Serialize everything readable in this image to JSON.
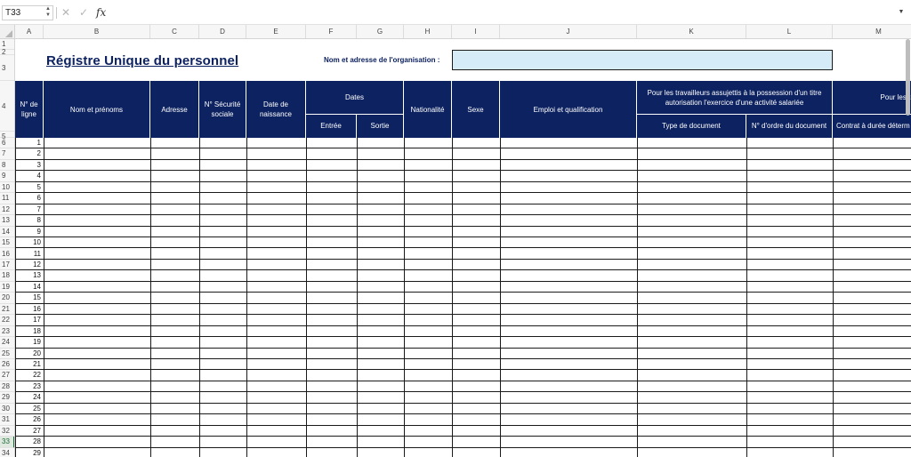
{
  "formula_bar": {
    "cell_ref": "T33",
    "cancel_icon": "close-icon",
    "confirm_icon": "check-icon",
    "function_symbol": "fx",
    "formula": ""
  },
  "columns": [
    "A",
    "B",
    "C",
    "D",
    "E",
    "F",
    "G",
    "H",
    "I",
    "J",
    "K",
    "L",
    "M"
  ],
  "rows": [
    "1",
    "2",
    "3",
    "4",
    "5",
    "6",
    "7",
    "8",
    "9",
    "10",
    "11",
    "12",
    "13",
    "14",
    "15",
    "16",
    "17",
    "18",
    "19",
    "20",
    "21",
    "22",
    "23",
    "24",
    "25",
    "26",
    "27",
    "28",
    "29",
    "30",
    "31",
    "32",
    "33",
    "34"
  ],
  "active_row": "33",
  "sheet": {
    "title": "Régistre Unique du personnel",
    "org_label": "Nom et adresse de l'organisation :",
    "org_value": "",
    "headers": {
      "line_no": "N° de ligne",
      "name": "Nom et prénoms",
      "address": "Adresse",
      "ssn": "N° Sécurité sociale",
      "birth": "Date de naissance",
      "dates": "Dates",
      "entry": "Entrée",
      "exit": "Sortie",
      "nationality": "Nationalité",
      "sex": "Sexe",
      "job": "Emploi et qualification",
      "foreign_workers": "Pour les travailleurs assujettis à la possession d'un titre autorisation l'exercice d'une activité salariée",
      "doc_type": "Type de document",
      "doc_order": "N° d'ordre du document",
      "others": "Pour les tr",
      "contract": "Contrat à durée déterm"
    },
    "line_numbers": [
      "1",
      "2",
      "3",
      "4",
      "5",
      "6",
      "7",
      "8",
      "9",
      "10",
      "11",
      "12",
      "13",
      "14",
      "15",
      "16",
      "17",
      "18",
      "19",
      "20",
      "21",
      "22",
      "23",
      "24",
      "25",
      "26",
      "27",
      "28",
      "29"
    ]
  },
  "colors": {
    "header_bg": "#0d2260",
    "header_text": "#ffffff",
    "org_input_bg": "#d5ecf8",
    "active_row": "#1e6b3a"
  }
}
